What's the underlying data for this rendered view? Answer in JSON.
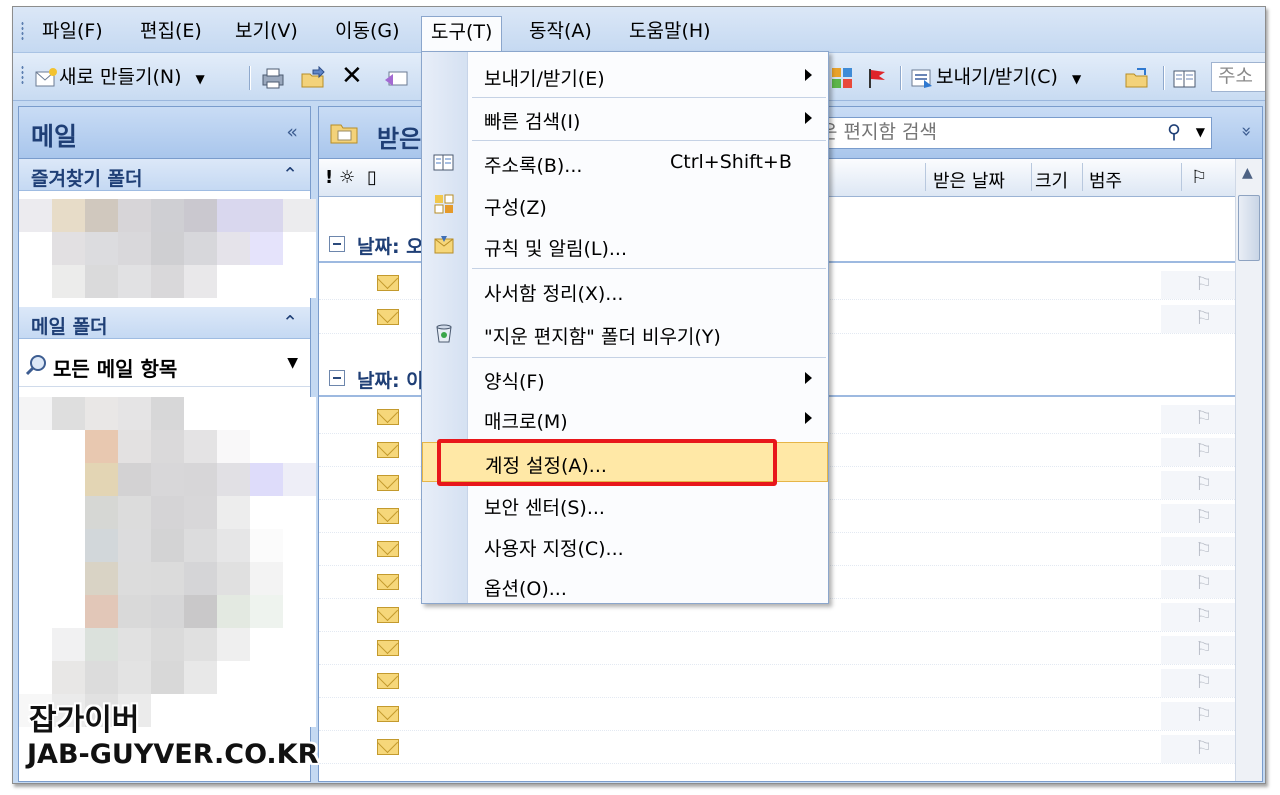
{
  "menubar": {
    "items": [
      "파일(F)",
      "편집(E)",
      "보기(V)",
      "이동(G)",
      "도구(T)",
      "동작(A)",
      "도움말(H)"
    ]
  },
  "toolbar": {
    "new_label": "새로 만들기(N)",
    "send_receive_label": "보내기/받기(C)",
    "address_partial": "주소"
  },
  "nav": {
    "title": "메일",
    "favorites_header": "즐겨찾기 폴더",
    "mail_folders_header": "메일 폴더",
    "all_mail_items": "모든 메일 항목"
  },
  "main": {
    "title_partial": "받은",
    "search_placeholder": "은 편지함 검색",
    "columns": {
      "received": "받은 날짜",
      "size": "크기",
      "category": "범주"
    },
    "groups": [
      "날짜: 오",
      "날짜: 이"
    ]
  },
  "tools_menu": {
    "items": [
      {
        "label": "보내기/받기(E)",
        "submenu": true
      },
      {
        "label": "빠른 검색(I)",
        "submenu": true
      },
      {
        "label": "주소록(B)...",
        "shortcut": "Ctrl+Shift+B",
        "icon": "address-book-icon"
      },
      {
        "label": "구성(Z)",
        "icon": "organize-icon"
      },
      {
        "label": "규칙 및 알림(L)...",
        "icon": "rules-icon"
      },
      {
        "label": "사서함 정리(X)..."
      },
      {
        "label": "\"지운 편지함\" 폴더 비우기(Y)",
        "icon": "recycle-bin-icon"
      },
      {
        "label": "양식(F)",
        "submenu": true
      },
      {
        "label": "매크로(M)",
        "submenu": true
      },
      {
        "label": "계정 설정(A)...",
        "highlighted": true
      },
      {
        "label": "보안 센터(S)..."
      },
      {
        "label": "사용자 지정(C)..."
      },
      {
        "label": "옵션(O)..."
      }
    ]
  },
  "watermark": {
    "line1": "잡가이버",
    "line2": "JAB-GUYVER.CO.KR"
  },
  "colors": {
    "highlight_box": "#e8171b",
    "menu_highlight": "#ffe8a6",
    "header_blue": "#a9c6ec"
  }
}
